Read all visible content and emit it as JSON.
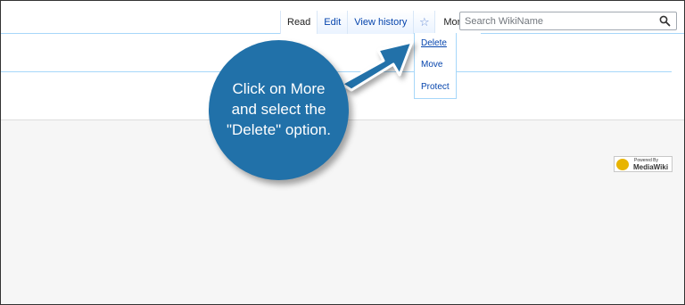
{
  "tabs": {
    "read": "Read",
    "edit": "Edit",
    "view_history": "View history",
    "more": "More"
  },
  "search": {
    "placeholder": "Search WikiName"
  },
  "menu": {
    "items": [
      "Delete",
      "Move",
      "Protect"
    ]
  },
  "callout": {
    "line1": "Click on More",
    "line2": "and select the",
    "line3": "\"Delete\" option.",
    "color": "#2171a9"
  },
  "footer": {
    "powered_by": "Powered By",
    "mediawiki": "MediaWiki"
  },
  "icons": {
    "watch": "star-icon",
    "search": "magnifier-icon",
    "more": "chevron-down-icon"
  }
}
